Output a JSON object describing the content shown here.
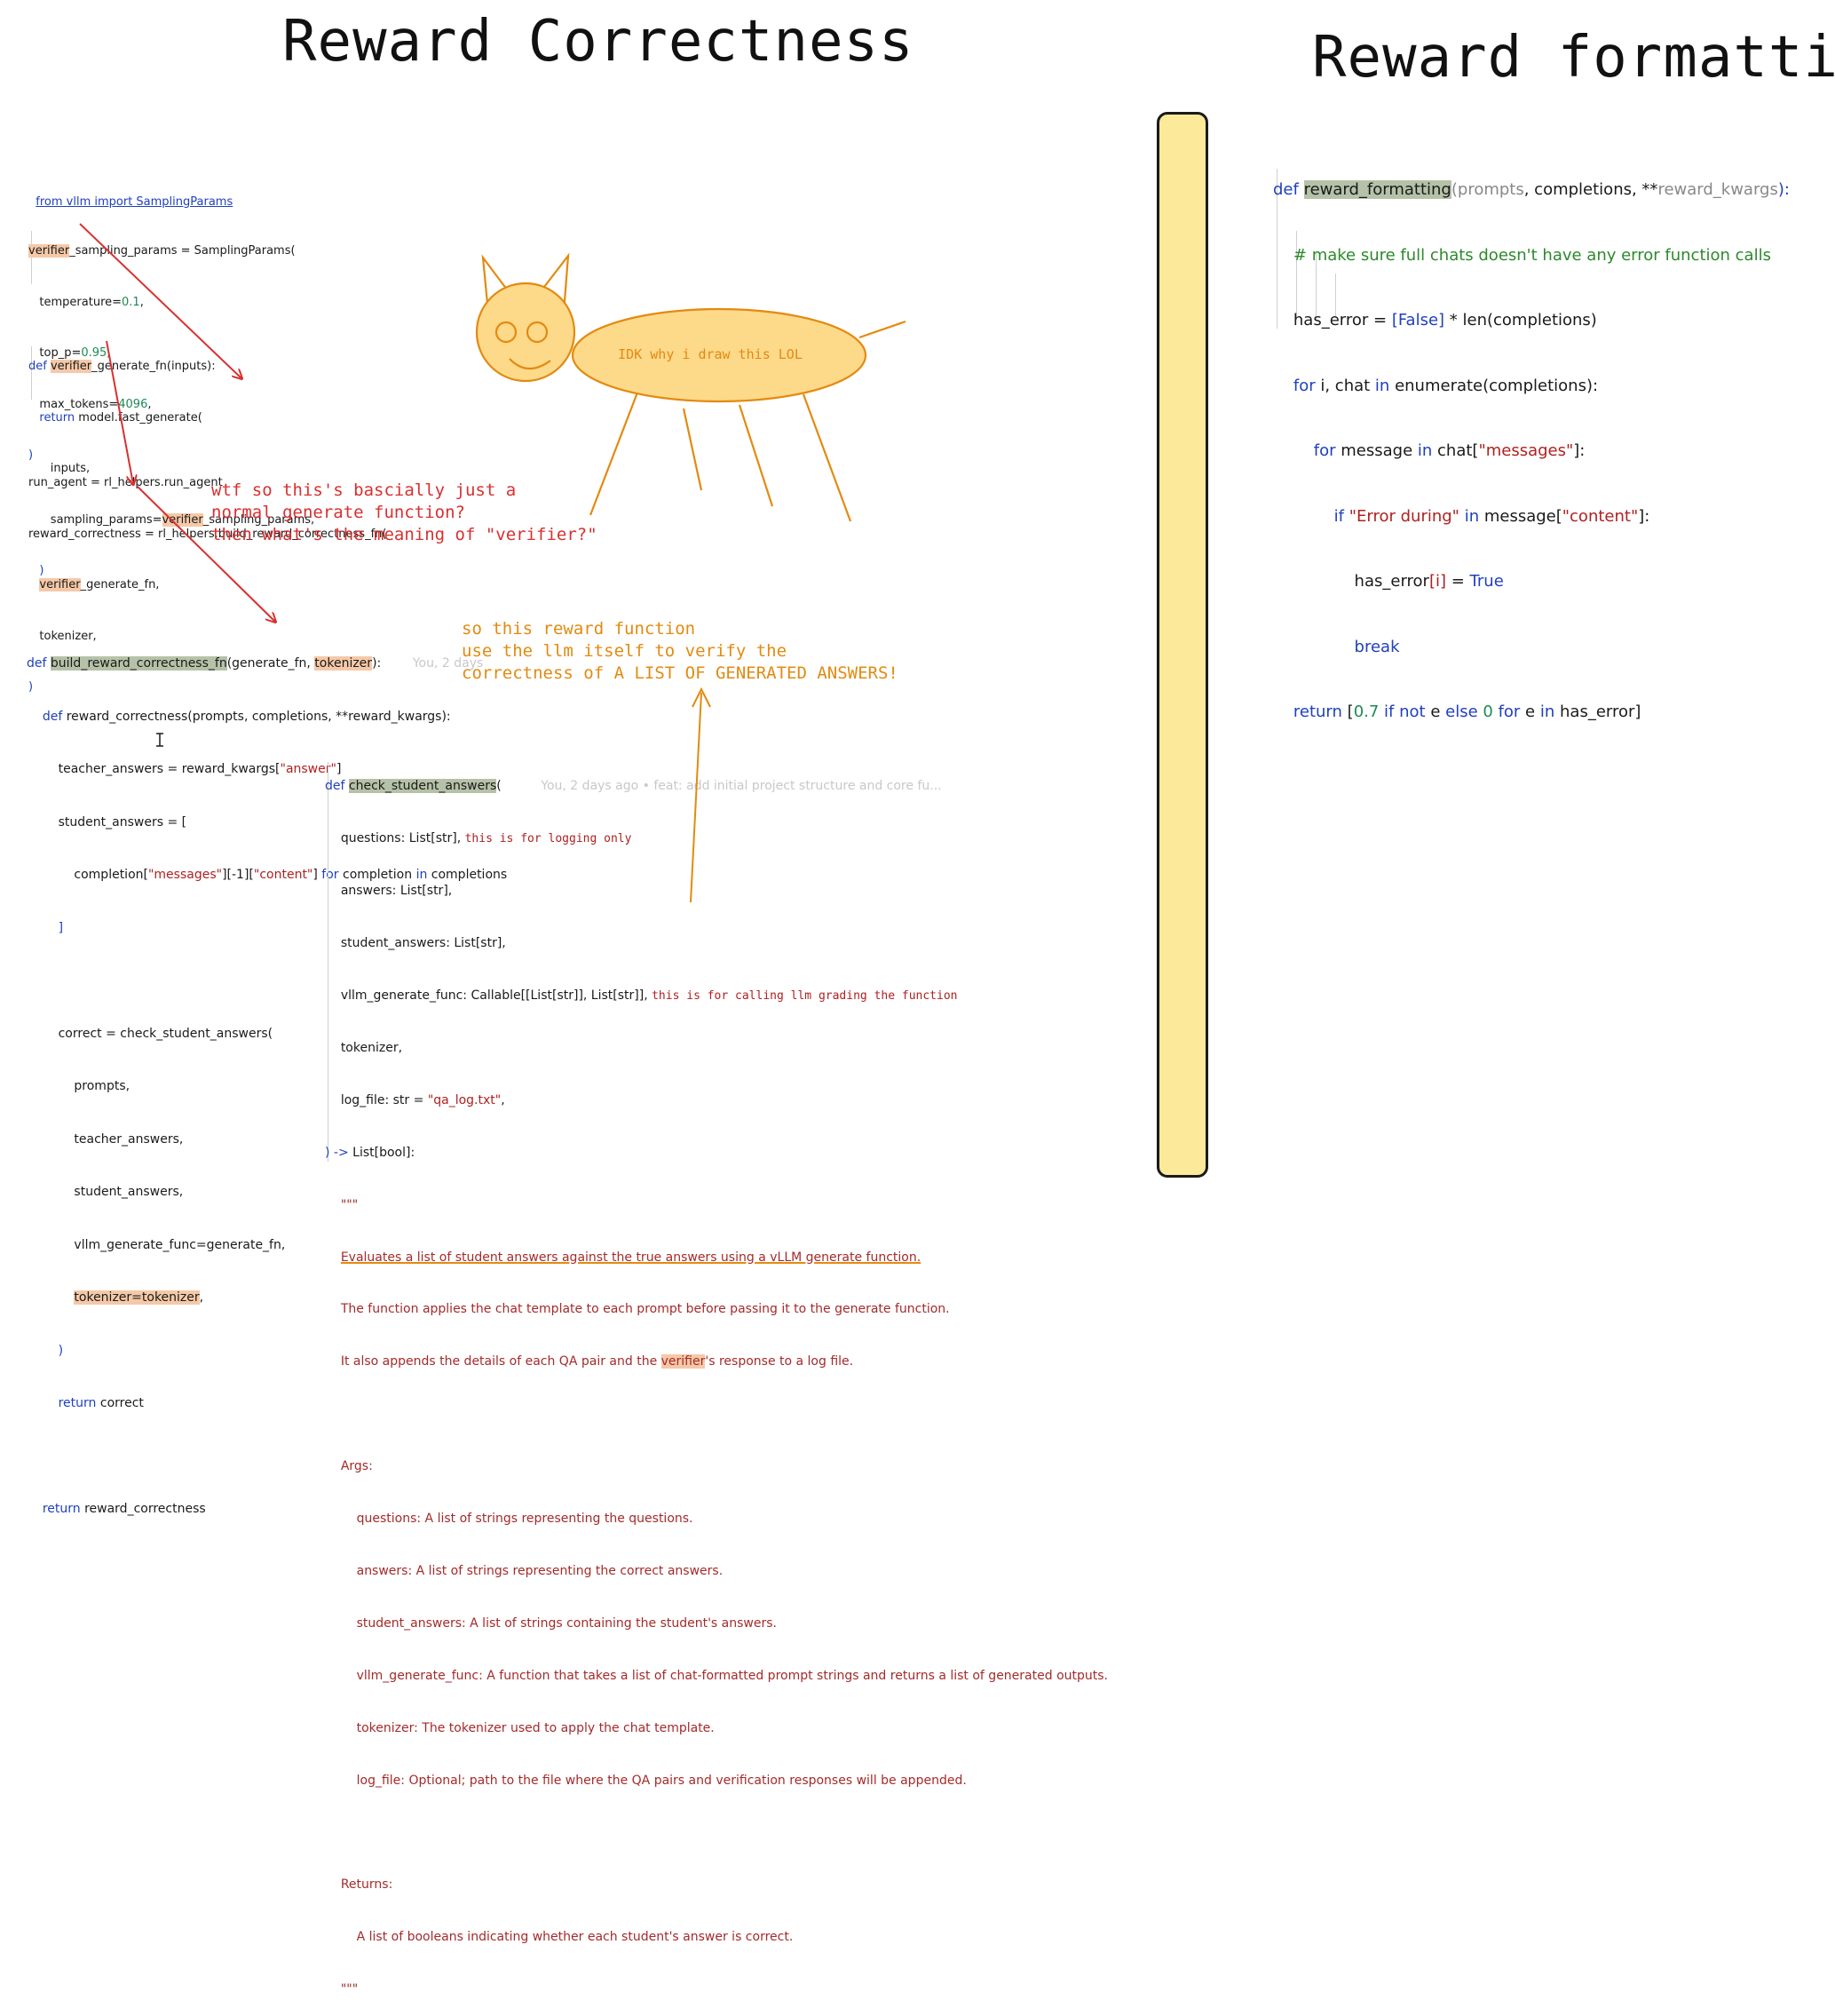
{
  "titles": {
    "left": "Reward Correctness",
    "right": "Reward formatting"
  },
  "code_import": {
    "line1": "from vllm import SamplingParams"
  },
  "code_sampling": {
    "l1_a": "verifier",
    "l1_b": "_sampling_params = SamplingParams(",
    "l2_a": "temperature=",
    "l2_b": "0.1",
    "l2_c": ",",
    "l3_a": "top_p=",
    "l3_b": "0.95",
    "l3_c": ",",
    "l4_a": "max_tokens=",
    "l4_b": "4096",
    "l4_c": ",",
    "l5": ")"
  },
  "code_generate_fn": {
    "l1_kw": "def ",
    "l1_a": "verifier",
    "l1_b": "_generate_fn(inputs):",
    "l2_kw": "return ",
    "l2_b": "model.fast_generate(",
    "l3": "inputs,",
    "l4_a": "sampling_params=",
    "l4_b": "verifier",
    "l4_c": "_sampling_params,",
    "l5": ")"
  },
  "code_run_agent": {
    "l1": "run_agent = rl_helpers.run_agent",
    "l2": "reward_correctness = rl_helpers.build_reward_correctness_fn(",
    "l3_a": "verifier",
    "l3_b": "_generate_fn,",
    "l4": "tokenizer,",
    "l5": ")"
  },
  "code_build": {
    "l1_kw": "def ",
    "l1_a": "build_reward_correctness_fn",
    "l1_b": "(generate_fn, ",
    "l1_c": "tokenizer",
    "l1_d": "):",
    "l1_ghost": "You, 2 days",
    "l2_kw": "def ",
    "l2_b": "reward_correctness(prompts, completions, **reward_kwargs):",
    "l3_a": "teacher_answers = reward_kwargs[",
    "l3_s": "\"answer\"",
    "l3_c": "]",
    "l4": "student_answers = [",
    "l5_a": "completion[",
    "l5_s1": "\"messages\"",
    "l5_b": "][-1][",
    "l5_s2": "\"content\"",
    "l5_c": "] ",
    "l5_kw1": "for",
    "l5_d": " completion ",
    "l5_kw2": "in",
    "l5_e": " completions",
    "l6": "]",
    "l7": "correct = check_student_answers(",
    "l8": "prompts,",
    "l9": "teacher_answers,",
    "l10": "student_answers,",
    "l11": "vllm_generate_func=generate_fn,",
    "l12_a": "tokenizer=tokenizer",
    "l12_b": ",",
    "l13": ")",
    "l14_kw": "return ",
    "l14_b": "correct",
    "l15_kw": "return ",
    "l15_b": "reward_correctness"
  },
  "code_check": {
    "l1_kw": "def ",
    "l1_a": "check_student_answers",
    "l1_b": "(",
    "l1_ghost": "You, 2 days ago • feat: add initial project structure and core fu...",
    "l2_a": "questions: List[str], ",
    "l2_note": "this is for logging only",
    "l3": "answers: List[str],",
    "l4": "student_answers: List[str],",
    "l5_a": "vllm_generate_func: Callable[[List[str]], List[str]], ",
    "l5_note": "this is for calling llm grading the function",
    "l6": "tokenizer,",
    "l7_a": "log_file: str = ",
    "l7_s": "\"qa_log.txt\"",
    "l7_c": ",",
    "l8_a": ") -> ",
    "l8_b": "List[bool]:",
    "l9": "\"\"\"",
    "d1": "Evaluates a list of student answers against the true answers using a vLLM generate function.",
    "d2": "The function applies the chat template to each prompt before passing it to the generate function.",
    "d3_a": "It also appends the details of each QA pair and the ",
    "d3_b": "verifier",
    "d3_c": "'s response to a log file.",
    "d5": "Args:",
    "d6": "questions: A list of strings representing the questions.",
    "d7": "answers: A list of strings representing the correct answers.",
    "d8": "student_answers: A list of strings containing the student's answers.",
    "d9": "vllm_generate_func: A function that takes a list of chat-formatted prompt strings and returns a list of generated outputs.",
    "d10": "tokenizer: The tokenizer used to apply the chat template.",
    "d11": "log_file: Optional; path to the file where the QA pairs and verification responses will be appended.",
    "d13": "Returns:",
    "d14": "A list of booleans indicating whether each student's answer is correct.",
    "d15": "\"\"\""
  },
  "notes": {
    "cat": "IDK why i draw this LOL",
    "wtf": "wtf so this's bascially just a\nnormal generate function?\nthen what's the meaning of \"verifier?\"",
    "so": "so this reward function\nuse the llm itself to verify the\ncorrectness of A LIST OF GENERATED ANSWERS!"
  },
  "code_formatting": {
    "l1_kw": "def ",
    "l1_a": "reward_formatting",
    "l1_p1": "(",
    "l1_p2": "prompts",
    "l1_p3": ", completions, **",
    "l1_p4": "reward_kwargs",
    "l1_p5": "):",
    "l2": "# make sure full chats doesn't have any error function calls",
    "l3_a": "has_error = ",
    "l3_b": "[False]",
    "l3_c": " * len(completions)",
    "l4_kw1": "for",
    "l4_a": " i, chat ",
    "l4_kw2": "in",
    "l4_b": " enumerate(completions):",
    "l5_kw1": "for",
    "l5_a": " message ",
    "l5_kw2": "in",
    "l5_b": " chat[",
    "l5_s": "\"messages\"",
    "l5_c": "]:",
    "l6_kw": "if ",
    "l6_s1": "\"Error during\"",
    "l6_kw2": " in",
    "l6_a": " message[",
    "l6_s2": "\"content\"",
    "l6_b": "]:",
    "l7_a": "has_error",
    "l7_b": "[i]",
    "l7_c": " = ",
    "l7_kw": "True",
    "l8_kw": "break",
    "l9_kw": "return ",
    "l9_a": "[",
    "l9_n1": "0.7",
    "l9_kw2": " if not",
    "l9_b": " e ",
    "l9_kw3": "else",
    "l9_n2": " 0",
    "l9_kw4": " for",
    "l9_c": " e ",
    "l9_kw5": "in",
    "l9_d": " has_error]"
  },
  "colors": {
    "arrow_red": "#d83030",
    "drawing_orange": "#e38a10",
    "cat_fill": "#fdd98a",
    "divider_fill": "#fde99a"
  }
}
